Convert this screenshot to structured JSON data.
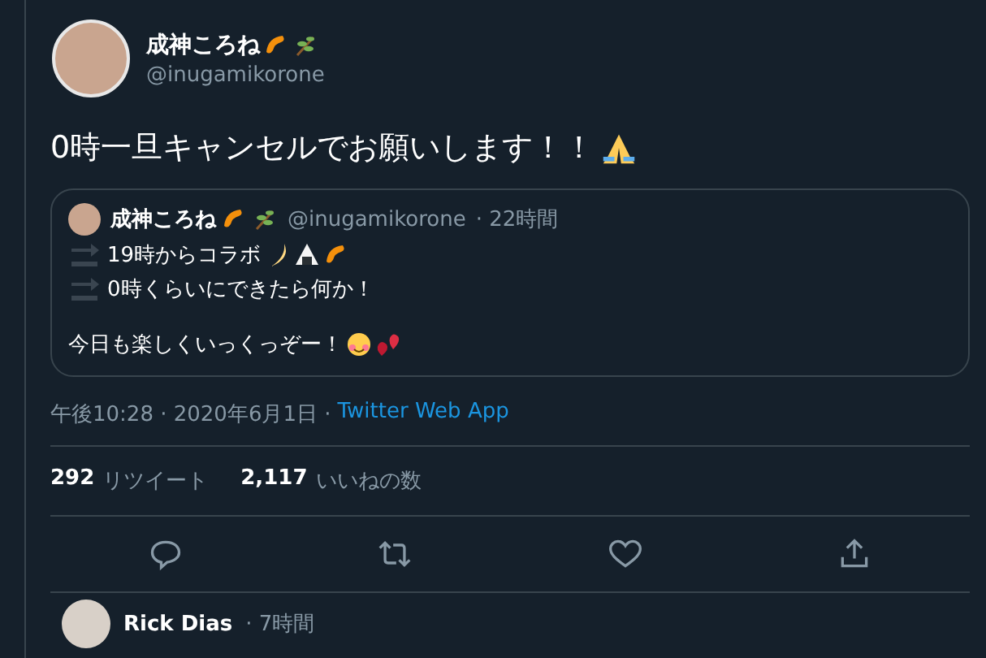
{
  "tweet": {
    "author": {
      "name": "成神ころね",
      "handle": "@inugamikorone"
    },
    "text": "0時一旦キャンセルでお願いします！！",
    "quote": {
      "author": {
        "name": "成神ころね",
        "handle": "@inugamikorone",
        "time": "· 22時間"
      },
      "lines": [
        "19時からコラボ",
        "0時くらいにできたら何か！",
        "今日も楽しくいっくっぞー！"
      ]
    },
    "timestamp": "午後10:28 · 2020年6月1日 ·",
    "source": "Twitter Web App",
    "stats": [
      {
        "count": "292",
        "label": "リツイート"
      },
      {
        "count": "2,117",
        "label": "いいねの数"
      }
    ]
  },
  "reply": {
    "name": "Rick Dias",
    "time": "· 7時間"
  }
}
